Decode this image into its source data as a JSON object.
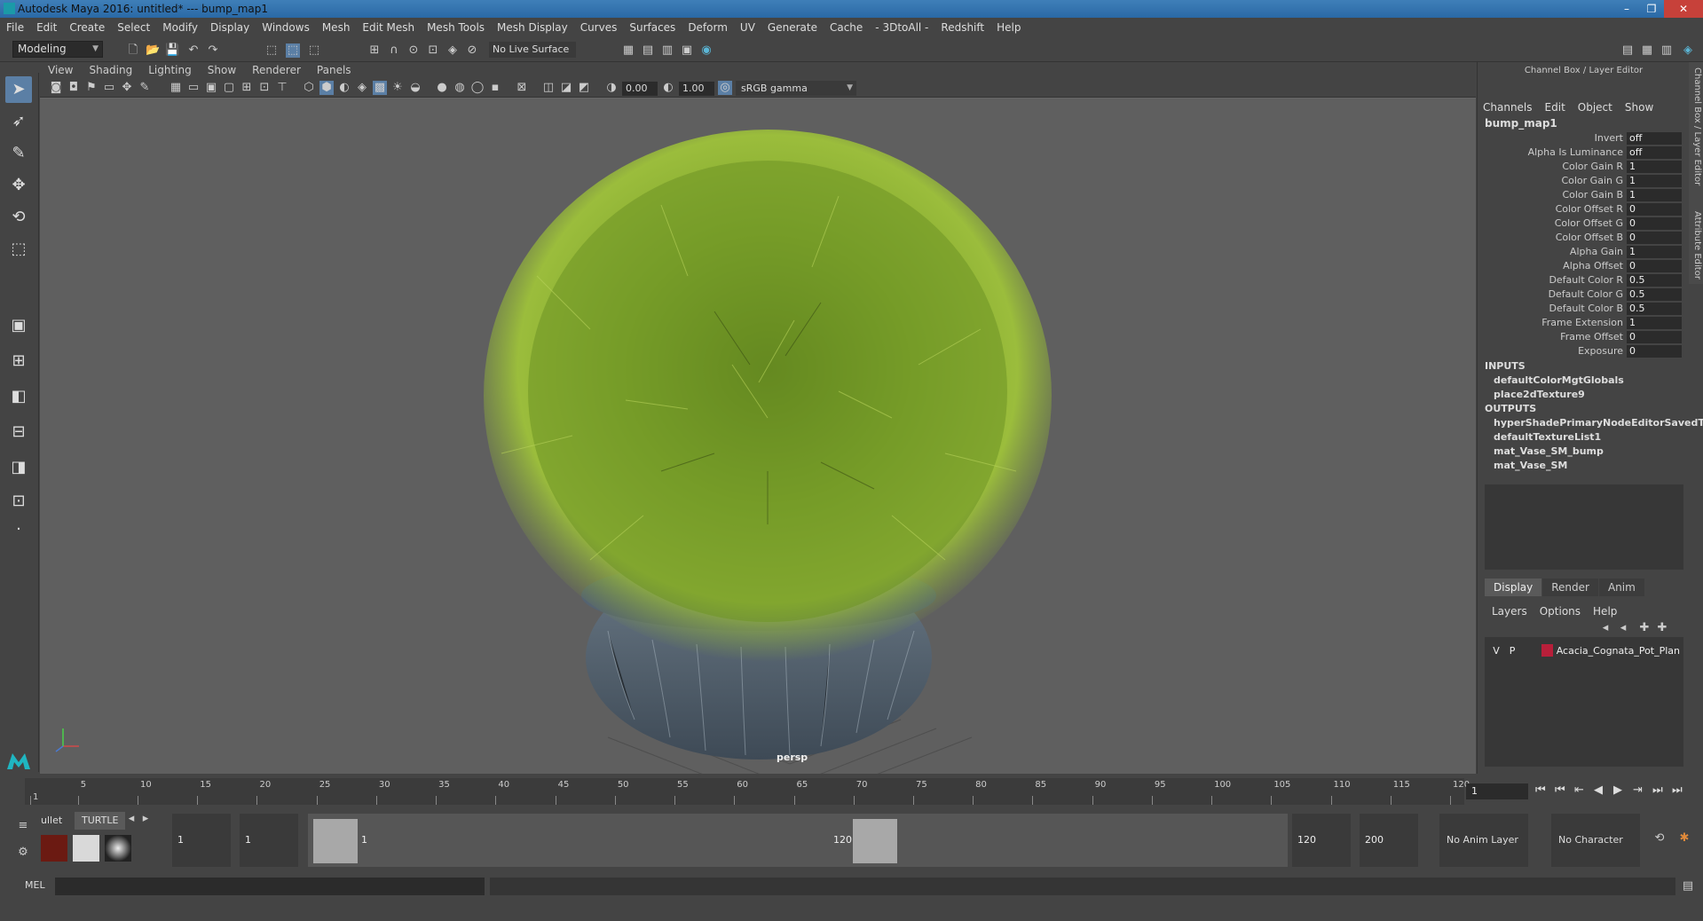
{
  "window": {
    "title": "Autodesk Maya 2016: untitled*   ---   bump_map1"
  },
  "menus": [
    "File",
    "Edit",
    "Create",
    "Select",
    "Modify",
    "Display",
    "Windows",
    "Mesh",
    "Edit Mesh",
    "Mesh Tools",
    "Mesh Display",
    "Curves",
    "Surfaces",
    "Deform",
    "UV",
    "Generate",
    "Cache",
    "- 3DtoAll -",
    "Redshift",
    "Help"
  ],
  "toolbar": {
    "mode": "Modeling",
    "live_surface": "No Live Surface"
  },
  "viewport": {
    "menus": [
      "View",
      "Shading",
      "Lighting",
      "Show",
      "Renderer",
      "Panels"
    ],
    "exposure": "0.00",
    "gamma": "1.00",
    "color_space": "sRGB gamma",
    "camera_label": "persp"
  },
  "channel_box": {
    "title": "Channel Box / Layer Editor",
    "menus": [
      "Channels",
      "Edit",
      "Object",
      "Show"
    ],
    "node": "bump_map1",
    "attributes": [
      {
        "label": "Invert",
        "value": "off"
      },
      {
        "label": "Alpha Is Luminance",
        "value": "off"
      },
      {
        "label": "Color Gain R",
        "value": "1"
      },
      {
        "label": "Color Gain G",
        "value": "1"
      },
      {
        "label": "Color Gain B",
        "value": "1"
      },
      {
        "label": "Color Offset R",
        "value": "0"
      },
      {
        "label": "Color Offset G",
        "value": "0"
      },
      {
        "label": "Color Offset B",
        "value": "0"
      },
      {
        "label": "Alpha Gain",
        "value": "1"
      },
      {
        "label": "Alpha Offset",
        "value": "0"
      },
      {
        "label": "Default Color R",
        "value": "0.5"
      },
      {
        "label": "Default Color G",
        "value": "0.5"
      },
      {
        "label": "Default Color B",
        "value": "0.5"
      },
      {
        "label": "Frame Extension",
        "value": "1"
      },
      {
        "label": "Frame Offset",
        "value": "0"
      },
      {
        "label": "Exposure",
        "value": "0"
      }
    ],
    "inputs_label": "INPUTS",
    "inputs": [
      "defaultColorMgtGlobals",
      "place2dTexture9"
    ],
    "outputs_label": "OUTPUTS",
    "outputs": [
      "hyperShadePrimaryNodeEditorSavedT...",
      "defaultTextureList1",
      "mat_Vase_SM_bump",
      "mat_Vase_SM"
    ]
  },
  "side_tabs": [
    "Channel Box / Layer Editor",
    "Attribute Editor"
  ],
  "layer_editor": {
    "tabs": [
      "Display",
      "Render",
      "Anim"
    ],
    "menus": [
      "Layers",
      "Options",
      "Help"
    ],
    "layer": {
      "v": "V",
      "p": "P",
      "name": "Acacia_Cognata_Pot_Plan",
      "color": "#b81f3a"
    }
  },
  "timeline": {
    "ticks": [
      "1",
      "5",
      "10",
      "15",
      "20",
      "25",
      "30",
      "35",
      "40",
      "45",
      "50",
      "55",
      "60",
      "65",
      "70",
      "75",
      "80",
      "85",
      "90",
      "95",
      "100",
      "105",
      "110",
      "115",
      "120"
    ],
    "current_frame": "1"
  },
  "range": {
    "shelf_tabs": [
      "ullet",
      "TURTLE"
    ],
    "start": "1",
    "start2": "1",
    "slider_start": "1",
    "slider_end": "120",
    "end": "120",
    "end2": "200",
    "anim_layer": "No Anim Layer",
    "char_set": "No Character Set"
  },
  "command": {
    "label": "MEL"
  }
}
